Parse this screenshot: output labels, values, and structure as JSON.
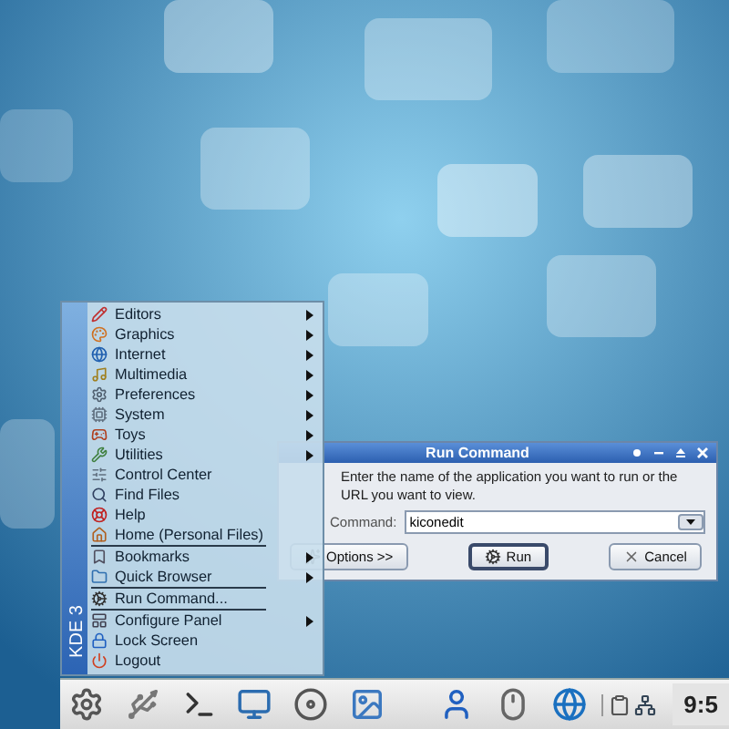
{
  "menu": {
    "side_label": "KDE 3",
    "sections": [
      [
        {
          "label": "Editors",
          "submenu": true
        },
        {
          "label": "Graphics",
          "submenu": true
        },
        {
          "label": "Internet",
          "submenu": true
        },
        {
          "label": "Multimedia",
          "submenu": true
        },
        {
          "label": "Preferences",
          "submenu": true
        },
        {
          "label": "System",
          "submenu": true
        },
        {
          "label": "Toys",
          "submenu": true
        },
        {
          "label": "Utilities",
          "submenu": true
        },
        {
          "label": "Control Center",
          "submenu": false
        },
        {
          "label": "Find Files",
          "submenu": false
        },
        {
          "label": "Help",
          "submenu": false
        },
        {
          "label": "Home (Personal Files)",
          "submenu": false
        }
      ],
      [
        {
          "label": "Bookmarks",
          "submenu": true
        },
        {
          "label": "Quick Browser",
          "submenu": true
        }
      ],
      [
        {
          "label": "Run Command...",
          "submenu": false
        }
      ],
      [
        {
          "label": "Configure Panel",
          "submenu": true
        },
        {
          "label": "Lock Screen",
          "submenu": false
        },
        {
          "label": "Logout",
          "submenu": false
        }
      ]
    ]
  },
  "dialog": {
    "title": "Run Command",
    "message": "Enter the name of the application you want to run or the URL you want to view.",
    "command_label": "Command:",
    "command_value": "kiconedit",
    "buttons": [
      {
        "label": "Options >>",
        "default": false
      },
      {
        "label": "Run",
        "default": true
      },
      {
        "label": "Cancel",
        "default": false
      }
    ]
  },
  "taskbar": {
    "clock": "9:5"
  }
}
